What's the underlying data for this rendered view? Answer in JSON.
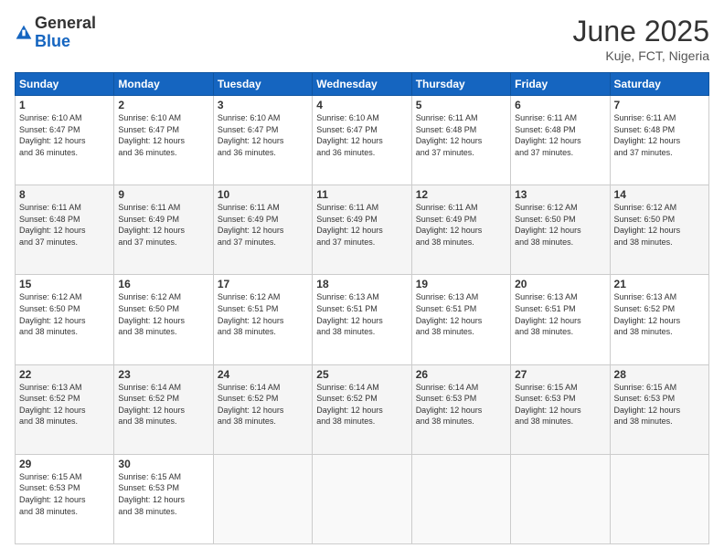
{
  "header": {
    "logo_general": "General",
    "logo_blue": "Blue",
    "month_title": "June 2025",
    "location": "Kuje, FCT, Nigeria"
  },
  "calendar": {
    "days_of_week": [
      "Sunday",
      "Monday",
      "Tuesday",
      "Wednesday",
      "Thursday",
      "Friday",
      "Saturday"
    ],
    "weeks": [
      [
        null,
        null,
        null,
        null,
        null,
        null,
        null
      ]
    ],
    "cells": [
      {
        "day": null,
        "info": ""
      },
      {
        "day": null,
        "info": ""
      },
      {
        "day": null,
        "info": ""
      },
      {
        "day": null,
        "info": ""
      },
      {
        "day": null,
        "info": ""
      },
      {
        "day": null,
        "info": ""
      },
      {
        "day": null,
        "info": ""
      },
      {
        "day": "1",
        "info": "Sunrise: 6:10 AM\nSunset: 6:47 PM\nDaylight: 12 hours\nand 36 minutes."
      },
      {
        "day": "2",
        "info": "Sunrise: 6:10 AM\nSunset: 6:47 PM\nDaylight: 12 hours\nand 36 minutes."
      },
      {
        "day": "3",
        "info": "Sunrise: 6:10 AM\nSunset: 6:47 PM\nDaylight: 12 hours\nand 36 minutes."
      },
      {
        "day": "4",
        "info": "Sunrise: 6:10 AM\nSunset: 6:47 PM\nDaylight: 12 hours\nand 36 minutes."
      },
      {
        "day": "5",
        "info": "Sunrise: 6:11 AM\nSunset: 6:48 PM\nDaylight: 12 hours\nand 37 minutes."
      },
      {
        "day": "6",
        "info": "Sunrise: 6:11 AM\nSunset: 6:48 PM\nDaylight: 12 hours\nand 37 minutes."
      },
      {
        "day": "7",
        "info": "Sunrise: 6:11 AM\nSunset: 6:48 PM\nDaylight: 12 hours\nand 37 minutes."
      },
      {
        "day": "8",
        "info": "Sunrise: 6:11 AM\nSunset: 6:48 PM\nDaylight: 12 hours\nand 37 minutes."
      },
      {
        "day": "9",
        "info": "Sunrise: 6:11 AM\nSunset: 6:49 PM\nDaylight: 12 hours\nand 37 minutes."
      },
      {
        "day": "10",
        "info": "Sunrise: 6:11 AM\nSunset: 6:49 PM\nDaylight: 12 hours\nand 37 minutes."
      },
      {
        "day": "11",
        "info": "Sunrise: 6:11 AM\nSunset: 6:49 PM\nDaylight: 12 hours\nand 37 minutes."
      },
      {
        "day": "12",
        "info": "Sunrise: 6:11 AM\nSunset: 6:49 PM\nDaylight: 12 hours\nand 38 minutes."
      },
      {
        "day": "13",
        "info": "Sunrise: 6:12 AM\nSunset: 6:50 PM\nDaylight: 12 hours\nand 38 minutes."
      },
      {
        "day": "14",
        "info": "Sunrise: 6:12 AM\nSunset: 6:50 PM\nDaylight: 12 hours\nand 38 minutes."
      },
      {
        "day": "15",
        "info": "Sunrise: 6:12 AM\nSunset: 6:50 PM\nDaylight: 12 hours\nand 38 minutes."
      },
      {
        "day": "16",
        "info": "Sunrise: 6:12 AM\nSunset: 6:50 PM\nDaylight: 12 hours\nand 38 minutes."
      },
      {
        "day": "17",
        "info": "Sunrise: 6:12 AM\nSunset: 6:51 PM\nDaylight: 12 hours\nand 38 minutes."
      },
      {
        "day": "18",
        "info": "Sunrise: 6:13 AM\nSunset: 6:51 PM\nDaylight: 12 hours\nand 38 minutes."
      },
      {
        "day": "19",
        "info": "Sunrise: 6:13 AM\nSunset: 6:51 PM\nDaylight: 12 hours\nand 38 minutes."
      },
      {
        "day": "20",
        "info": "Sunrise: 6:13 AM\nSunset: 6:51 PM\nDaylight: 12 hours\nand 38 minutes."
      },
      {
        "day": "21",
        "info": "Sunrise: 6:13 AM\nSunset: 6:52 PM\nDaylight: 12 hours\nand 38 minutes."
      },
      {
        "day": "22",
        "info": "Sunrise: 6:13 AM\nSunset: 6:52 PM\nDaylight: 12 hours\nand 38 minutes."
      },
      {
        "day": "23",
        "info": "Sunrise: 6:14 AM\nSunset: 6:52 PM\nDaylight: 12 hours\nand 38 minutes."
      },
      {
        "day": "24",
        "info": "Sunrise: 6:14 AM\nSunset: 6:52 PM\nDaylight: 12 hours\nand 38 minutes."
      },
      {
        "day": "25",
        "info": "Sunrise: 6:14 AM\nSunset: 6:52 PM\nDaylight: 12 hours\nand 38 minutes."
      },
      {
        "day": "26",
        "info": "Sunrise: 6:14 AM\nSunset: 6:53 PM\nDaylight: 12 hours\nand 38 minutes."
      },
      {
        "day": "27",
        "info": "Sunrise: 6:15 AM\nSunset: 6:53 PM\nDaylight: 12 hours\nand 38 minutes."
      },
      {
        "day": "28",
        "info": "Sunrise: 6:15 AM\nSunset: 6:53 PM\nDaylight: 12 hours\nand 38 minutes."
      },
      {
        "day": "29",
        "info": "Sunrise: 6:15 AM\nSunset: 6:53 PM\nDaylight: 12 hours\nand 38 minutes."
      },
      {
        "day": "30",
        "info": "Sunrise: 6:15 AM\nSunset: 6:53 PM\nDaylight: 12 hours\nand 38 minutes."
      },
      null,
      null,
      null,
      null,
      null
    ]
  }
}
